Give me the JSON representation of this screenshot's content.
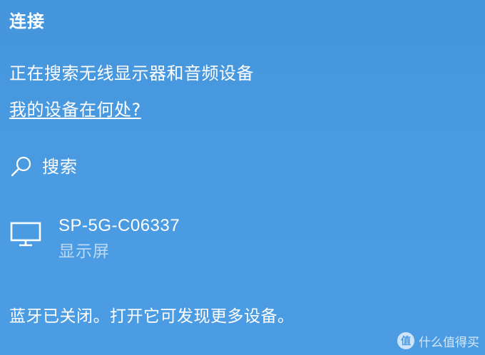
{
  "panel": {
    "title": "连接",
    "status": "正在搜索无线显示器和音频设备",
    "help_link": "我的设备在何处?",
    "search": {
      "icon": "search-icon",
      "label": "搜索"
    },
    "devices": [
      {
        "icon": "monitor-icon",
        "name": "SP-5G-C06337",
        "type": "显示屏"
      }
    ],
    "bluetooth_note": "蓝牙已关闭。打开它可发现更多设备。"
  },
  "watermark": {
    "badge": "值",
    "text": "什么值得买"
  },
  "colors": {
    "background": "#4a9be2",
    "text": "#ffffff",
    "secondary_text": "#bcd9f5"
  }
}
